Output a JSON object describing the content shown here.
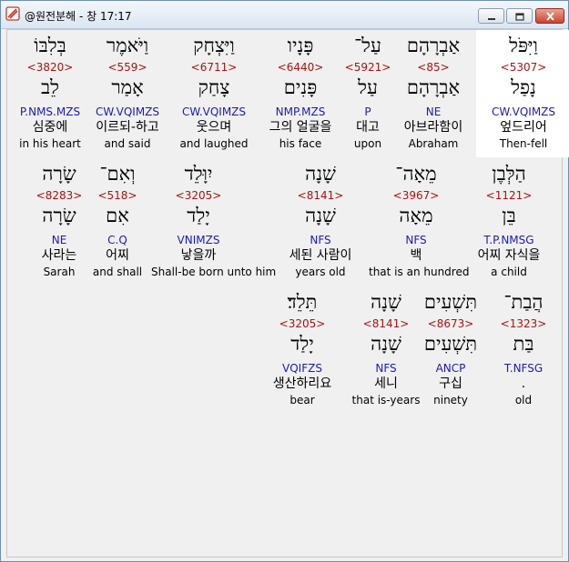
{
  "window": {
    "title": "@원전분해 - 창 17:17"
  },
  "icons": {
    "app": "app-logo-icon",
    "minimize": "minimize-icon",
    "maximize": "maximize-icon",
    "close": "close-icon"
  },
  "colors": {
    "strong_number": "#b01010",
    "grammar_code": "#1b1bb8",
    "highlight": "#ffffff"
  },
  "words": [
    {
      "heb": "וַיִּפֹּל",
      "num": "<5307>",
      "root": "נָפַל",
      "gram": "CW.VQIMZS",
      "kor": "엎드리어",
      "eng": "Then-fell",
      "highlight": true
    },
    {
      "heb": "אַבְרָהָם",
      "num": "<85>",
      "root": "אַבְרָהָם",
      "gram": "NE",
      "kor": "아브라함이",
      "eng": "Abraham"
    },
    {
      "heb": "עַל־",
      "num": "<5921>",
      "root": "עַל",
      "gram": "P",
      "kor": "대고",
      "eng": "upon"
    },
    {
      "heb": "פָּנָיו",
      "num": "<6440>",
      "root": "פָּנִים",
      "gram": "NMP.MZS",
      "kor": "그의 얼굴을",
      "eng": "his face"
    },
    {
      "heb": "וַיִּצְחָק",
      "num": "<6711>",
      "root": "צָחַק",
      "gram": "CW.VQIMZS",
      "kor": "웃으며",
      "eng": "and laughed"
    },
    {
      "heb": "וַיֹּאמֶר",
      "num": "<559>",
      "root": "אָמַר",
      "gram": "CW.VQIMZS",
      "kor": "이르되-하고",
      "eng": "and said"
    },
    {
      "heb": "בְּלִבּוֹ",
      "num": "<3820>",
      "root": "לֵב",
      "gram": "P.NMS.MZS",
      "kor": "심중에",
      "eng": "in his heart"
    },
    {
      "heb": "הַלְּבֶן",
      "num": "<1121>",
      "root": "בֵּן",
      "gram": "T.P.NMSG",
      "kor": "어찌 자식을",
      "eng": "a child"
    },
    {
      "heb": "מֵאָה־",
      "num": "<3967>",
      "root": "מֵאָה",
      "gram": "NFS",
      "kor": "백",
      "eng": "that is an hundred"
    },
    {
      "heb": "שָׁנָה",
      "num": "<8141>",
      "root": "שָׁנָה",
      "gram": "NFS",
      "kor": "세된 사람이",
      "eng": "years old"
    },
    {
      "heb": "יִוָּלֵד",
      "num": "<3205>",
      "root": "יָלַד",
      "gram": "VNIMZS",
      "kor": "낳을까",
      "eng": "Shall-be born unto him"
    },
    {
      "heb": "וְאִם־",
      "num": "<518>",
      "root": "אִם",
      "gram": "C.Q",
      "kor": "어찌",
      "eng": "and shall"
    },
    {
      "heb": "שָׂרָה",
      "num": "<8283>",
      "root": "שָׂרָה",
      "gram": "NE",
      "kor": "사라는",
      "eng": "Sarah"
    },
    {
      "heb": "הֲבַת־",
      "num": "<1323>",
      "root": "בַּת",
      "gram": "T.NFSG",
      "kor": ".",
      "eng": "old"
    },
    {
      "heb": "תִּשְׁעִים",
      "num": "<8673>",
      "root": "תִּשְׁעִים",
      "gram": "ANCP",
      "kor": "구십",
      "eng": "ninety"
    },
    {
      "heb": "שָׁנָה",
      "num": "<8141>",
      "root": "שָׁנָה",
      "gram": "NFS",
      "kor": "세니",
      "eng": "that is-years"
    },
    {
      "heb": "תֵּלֵד׃",
      "num": "<3205>",
      "root": "יָלַד",
      "gram": "VQIFZS",
      "kor": "생산하리요",
      "eng": "bear"
    }
  ]
}
